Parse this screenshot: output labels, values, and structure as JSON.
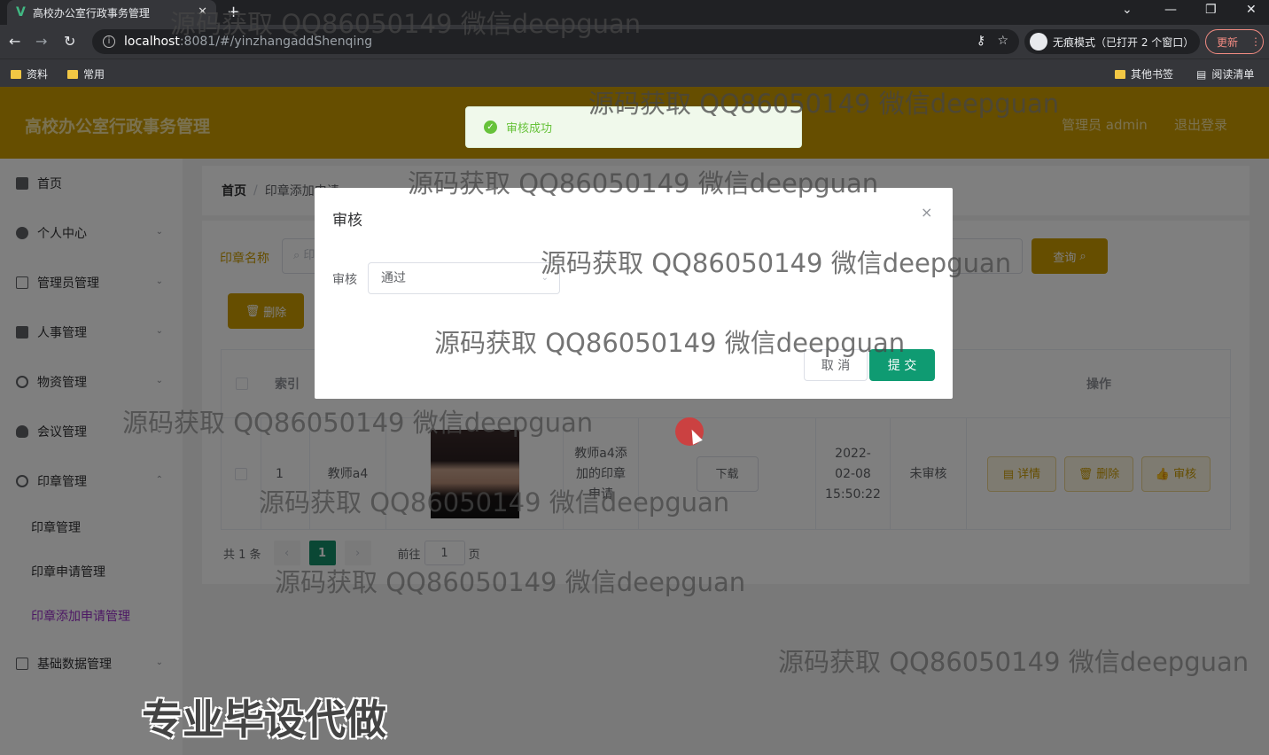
{
  "browser": {
    "tab_title": "高校办公室行政事务管理",
    "url_host": "localhost",
    "url_path": ":8081/#/yinzhangaddShenqing",
    "incognito_label": "无痕模式（已打开 2 个窗口）",
    "update_label": "更新",
    "bookmarks": [
      "资料",
      "常用"
    ],
    "other_bookmarks": "其他书签",
    "reading_list": "阅读清单"
  },
  "header": {
    "title": "高校办公室行政事务管理",
    "user": "管理员 admin",
    "logout": "退出登录"
  },
  "sidebar": {
    "items": [
      {
        "label": "首页",
        "icon": "home-icon"
      },
      {
        "label": "个人中心",
        "icon": "user-icon"
      },
      {
        "label": "管理员管理",
        "icon": "id-card-icon"
      },
      {
        "label": "人事管理",
        "icon": "books-icon"
      },
      {
        "label": "物资管理",
        "icon": "compass-icon"
      },
      {
        "label": "会议管理",
        "icon": "bulb-icon"
      },
      {
        "label": "印章管理",
        "icon": "stamp-icon"
      }
    ],
    "sub_items": [
      "印章管理",
      "印章申请管理",
      "印章添加申请管理"
    ],
    "last_item": {
      "label": "基础数据管理",
      "icon": "mail-icon"
    }
  },
  "breadcrumb": {
    "home": "首页",
    "current": "印章添加申请"
  },
  "search": {
    "label": "印章名称",
    "placeholder": "印",
    "query_button": "查询"
  },
  "delete_button": "删除",
  "table": {
    "headers": {
      "index": "索引",
      "actions": "操作"
    },
    "row": {
      "index": "1",
      "applicant": "教师a4",
      "description": "教师a4添加的印章申请",
      "download": "下载",
      "time": "2022-02-08 15:50:22",
      "status": "未审核",
      "actions": [
        "详情",
        "删除",
        "审核"
      ]
    }
  },
  "pagination": {
    "total": "共 1 条",
    "page": "1",
    "goto": "前往",
    "goto_value": "1",
    "page_unit": "页"
  },
  "dialog": {
    "title": "审核",
    "close": "×",
    "field_label": "审核",
    "field_value": "通过",
    "cancel": "取 消",
    "submit": "提 交"
  },
  "toast": {
    "message": "审核成功"
  },
  "watermark": "源码获取 QQ86050149 微信deepguan",
  "promo_text": "专业毕设代做"
}
